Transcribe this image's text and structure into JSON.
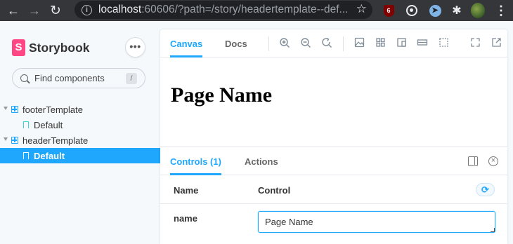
{
  "browser": {
    "url_host": "localhost",
    "url_rest": ":60606/?path=/story/headertemplate--def...",
    "back_icon": "←",
    "forward_icon": "→",
    "reload_icon": "↻",
    "star_icon": "☆",
    "info_icon": "i",
    "ublock_badge": "6",
    "puzzle_icon": "✱",
    "menu_icon": "⋮"
  },
  "sidebar": {
    "brand_logo": "S",
    "brand_name": "Storybook",
    "more_label": "•••",
    "search_placeholder": "Find components",
    "search_shortcut": "/",
    "tree": [
      {
        "label": "footerTemplate",
        "type": "component",
        "expanded": true
      },
      {
        "label": "Default",
        "type": "story",
        "selected": false
      },
      {
        "label": "headerTemplate",
        "type": "component",
        "expanded": true
      },
      {
        "label": "Default",
        "type": "story",
        "selected": true
      }
    ]
  },
  "toolbar": {
    "tabs": [
      {
        "label": "Canvas",
        "active": true
      },
      {
        "label": "Docs",
        "active": false
      }
    ],
    "icons": [
      "zoom-in-icon",
      "zoom-out-icon",
      "zoom-reset-icon",
      "background-icon",
      "grid-icon",
      "viewport-icon",
      "measure-icon",
      "outline-icon",
      "fullscreen-icon",
      "open-new-tab-icon"
    ]
  },
  "canvas": {
    "heading": "Page Name"
  },
  "addons": {
    "tabs": [
      {
        "label": "Controls (1)",
        "active": true
      },
      {
        "label": "Actions",
        "active": false
      }
    ],
    "columns": {
      "name": "Name",
      "control": "Control"
    },
    "reset_icon": "⟳",
    "rows": [
      {
        "name": "name",
        "value": "Page Name"
      }
    ]
  },
  "colors": {
    "accent": "#1ea7fd",
    "brand": "#ff4785",
    "chrome": "#35363a"
  }
}
